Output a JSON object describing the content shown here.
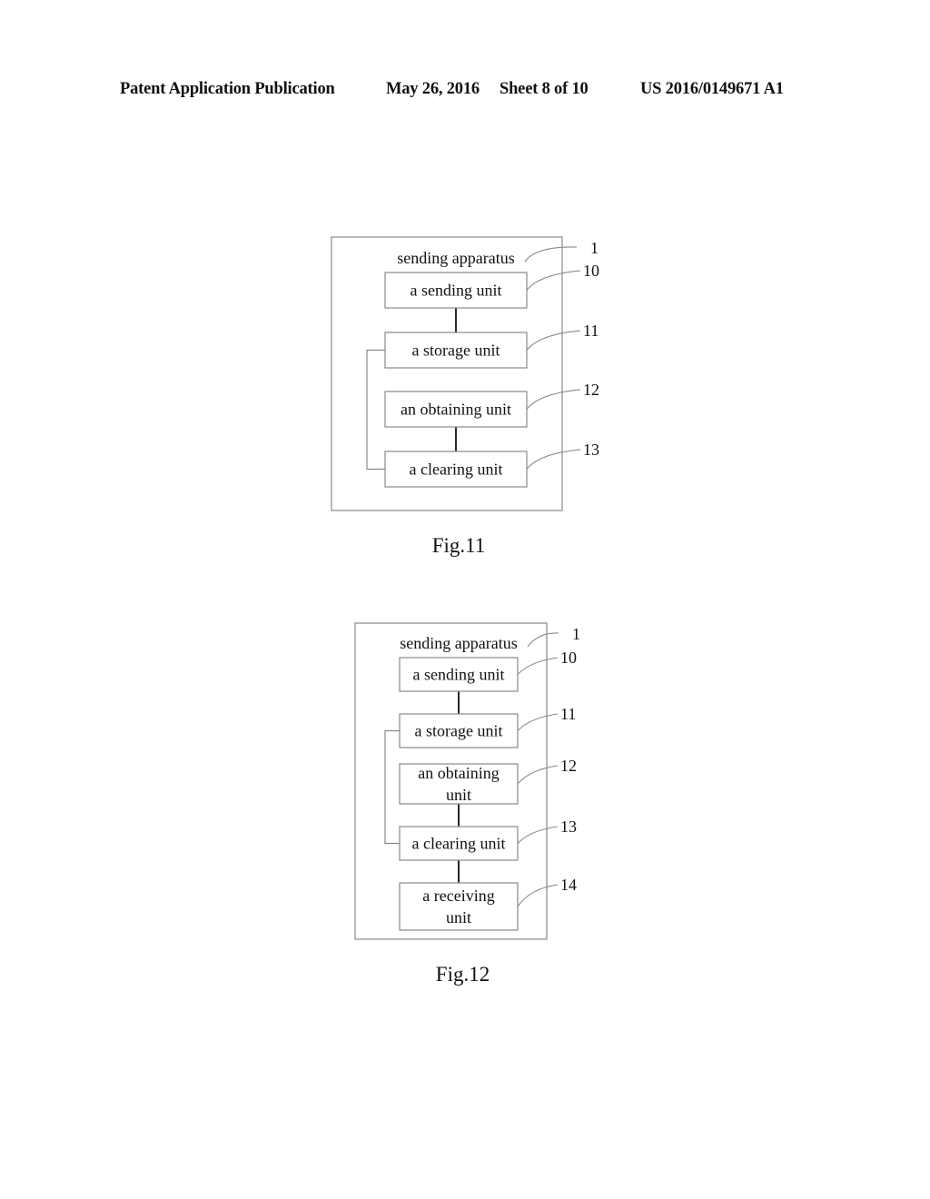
{
  "header": {
    "publication": "Patent Application Publication",
    "date": "May 26, 2016",
    "sheet": "Sheet 8 of 10",
    "number": "US 2016/0149671 A1"
  },
  "figures": [
    {
      "caption": "Fig.11",
      "apparatus": {
        "label": "sending apparatus",
        "ref": "1"
      },
      "units": [
        {
          "lines": [
            "a sending unit"
          ],
          "ref": "10"
        },
        {
          "lines": [
            "a storage unit"
          ],
          "ref": "11"
        },
        {
          "lines": [
            "an obtaining unit"
          ],
          "ref": "12"
        },
        {
          "lines": [
            "a clearing unit"
          ],
          "ref": "13"
        }
      ],
      "connections": [
        {
          "from": "a sending unit",
          "to": "a storage unit",
          "type": "direct"
        },
        {
          "from": "an obtaining unit",
          "to": "a clearing unit",
          "type": "direct"
        },
        {
          "from": "a storage unit",
          "to": "a clearing unit",
          "type": "bracket"
        }
      ]
    },
    {
      "caption": "Fig.12",
      "apparatus": {
        "label": "sending apparatus",
        "ref": "1"
      },
      "units": [
        {
          "lines": [
            "a sending unit"
          ],
          "ref": "10"
        },
        {
          "lines": [
            "a storage unit"
          ],
          "ref": "11"
        },
        {
          "lines": [
            "an obtaining",
            "unit"
          ],
          "ref": "12"
        },
        {
          "lines": [
            "a clearing unit"
          ],
          "ref": "13"
        },
        {
          "lines": [
            "a receiving",
            "unit"
          ],
          "ref": "14"
        }
      ],
      "connections": [
        {
          "from": "a sending unit",
          "to": "a storage unit",
          "type": "direct"
        },
        {
          "from": "an obtaining unit",
          "to": "a clearing unit",
          "type": "direct"
        },
        {
          "from": "a clearing unit",
          "to": "a receiving unit",
          "type": "direct"
        },
        {
          "from": "a storage unit",
          "to": "a clearing unit",
          "type": "bracket"
        }
      ]
    }
  ]
}
